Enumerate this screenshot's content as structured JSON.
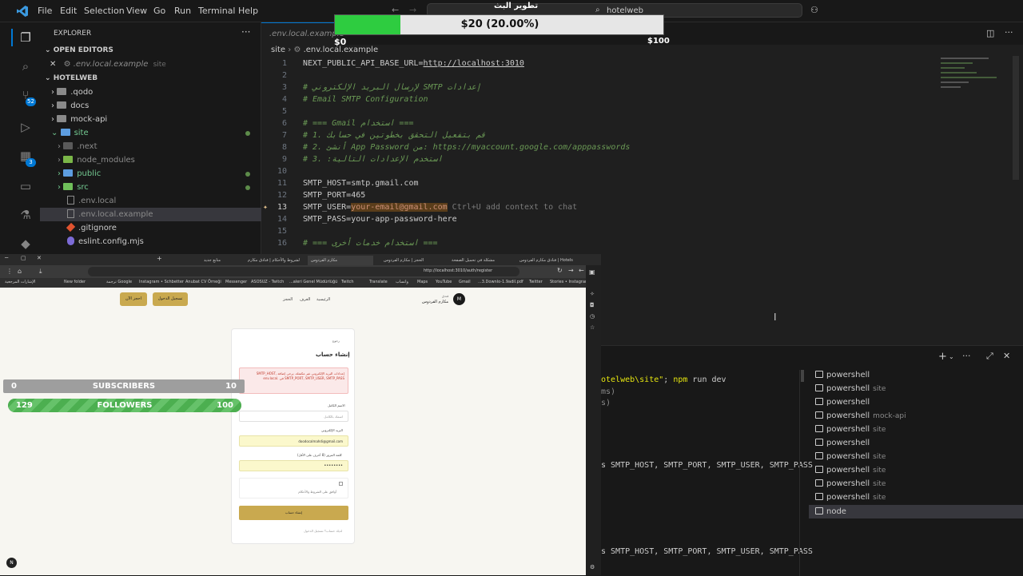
{
  "menu": [
    "File",
    "Edit",
    "Selection",
    "View",
    "Go",
    "Run",
    "Terminal",
    "Help"
  ],
  "search": "hotelweb",
  "explorer": {
    "title": "EXPLORER",
    "open_editors": "OPEN EDITORS",
    "open_file": ".env.local.example",
    "open_file_folder": "site",
    "project": "HOTELWEB",
    "tree": [
      ".qodo",
      "docs",
      "mock-api",
      "site",
      ".next",
      "node_modules",
      "public",
      "src",
      ".env.local",
      ".env.local.example",
      ".gitignore",
      "eslint.config.mjs"
    ]
  },
  "activity_badges": {
    "source_control": "52",
    "extensions": "3"
  },
  "editor": {
    "tab": ".env.local.example",
    "breadcrumb_folder": "site",
    "breadcrumb_file": ".env.local.example",
    "lines": [
      {
        "n": "1",
        "text": "NEXT_PUBLIC_API_BASE_URL=http://localhost:3010"
      },
      {
        "n": "2",
        "text": ""
      },
      {
        "n": "3",
        "text": "# لإرسال البريد الإلكتروني SMTP إعدادات"
      },
      {
        "n": "4",
        "text": "# Email SMTP Configuration"
      },
      {
        "n": "5",
        "text": ""
      },
      {
        "n": "6",
        "text": "# === Gmail استخدام ==="
      },
      {
        "n": "7",
        "text": "# 1. قم بتفعيل التحقق بخطوتين في حسابك"
      },
      {
        "n": "8",
        "text": "# 2. أنشئ App Password من: https://myaccount.google.com/apppasswords"
      },
      {
        "n": "9",
        "text": "# 3. :استخدم الإعدادات التالية"
      },
      {
        "n": "10",
        "text": ""
      },
      {
        "n": "11",
        "text": "SMTP_HOST=smtp.gmail.com"
      },
      {
        "n": "12",
        "text": "SMTP_PORT=465"
      },
      {
        "n": "13",
        "text": "SMTP_USER=your-email@gmail.com"
      },
      {
        "n": "14",
        "text": "SMTP_PASS=your-app-password-here"
      },
      {
        "n": "15",
        "text": ""
      },
      {
        "n": "16",
        "text": "# === استخدام خدمات أخرى ==="
      }
    ],
    "inline_hint": "Ctrl+U add context to chat"
  },
  "donation": {
    "title": "تطوير البث",
    "label": "$20 (20.00%)",
    "min": "$0",
    "max": "$100",
    "progress": 0.2,
    "fill_color": "#2ecc40"
  },
  "browser": {
    "tabs": [
      "متابع جديد",
      "الشروط والأحكام | فنادق مكارم",
      "مكارم الفردوس",
      "الحجز | مكارم الفردوس",
      "مشكلة في تحميل الصفحة",
      "فنادق مكارم الفردوس | Hotels",
      "فندق مكارم الفردوس"
    ],
    "url": "http://localhost:3010/auth/register",
    "bookmarks": [
      "New folder",
      "ترجمة Google",
      "Instagram • Schbetter",
      "Anubat CV Örneği",
      "Messenger",
      "ASOSUZ - Twitch",
      "...aleri Genel Müdürlüğü",
      "Twitch",
      "Translate",
      "واتساب",
      "Maps",
      "YouTube",
      "Gmail",
      "...3.Downlo-1.9adil.pdf",
      "Twitter",
      "Stories • Instagram",
      "الإشارات المرجعية"
    ],
    "nav_buttons": [
      "تسجيل الدخول",
      "احجز الآن"
    ],
    "nav_links": [
      "الرئيسية",
      "الغرف",
      "الحجز"
    ],
    "brand_sub": "فندق",
    "brand": "مكارم الفردوس",
    "brand_initial": "M",
    "form": {
      "back": "رجوع",
      "title": "إنشاء حساب",
      "error": "إعدادات البريد الإلكتروني غير مكتملة. يرجى إضافة SMTP_HOST, SMTP_PORT, SMTP_USER, SMTP_PASS في .env.local",
      "name_label": "الاسم الكامل",
      "name_placeholder": "اسمك بالكامل",
      "email_label": "البريد الإلكتروني",
      "email_value": "doodocalmahdi@gmail.com",
      "password_label": "كلمة المرور (8 أحرف على الأقل)",
      "password_value": "••••••••",
      "terms": "أوافق على الشروط والأحكام",
      "submit": "إنشاء حساب",
      "footer": "لديك حساب؟ تسجيل الدخول"
    }
  },
  "overlays": {
    "subscribers": {
      "label": "SUBSCRIBERS",
      "current": "0",
      "goal": "10",
      "progress": 0.0
    },
    "followers": {
      "label": "FOLLOWERS",
      "current": "129",
      "goal": "100",
      "progress": 1.0
    }
  },
  "terminal": {
    "lines": [
      "otelweb\\site\"; npm run dev",
      "ms)",
      "s)",
      "s SMTP_HOST, SMTP_PORT, SMTP_USER, SMTP_PASS",
      "s SMTP_HOST, SMTP_PORT, SMTP_USER, SMTP_PASS"
    ],
    "instances": [
      {
        "name": "powershell",
        "sub": ""
      },
      {
        "name": "powershell",
        "sub": "site"
      },
      {
        "name": "powershell",
        "sub": ""
      },
      {
        "name": "powershell",
        "sub": "mock-api"
      },
      {
        "name": "powershell",
        "sub": "site"
      },
      {
        "name": "powershell",
        "sub": ""
      },
      {
        "name": "powershell",
        "sub": "site"
      },
      {
        "name": "powershell",
        "sub": "site"
      },
      {
        "name": "powershell",
        "sub": "site"
      },
      {
        "name": "powershell",
        "sub": "site"
      },
      {
        "name": "node",
        "sub": ""
      }
    ]
  }
}
